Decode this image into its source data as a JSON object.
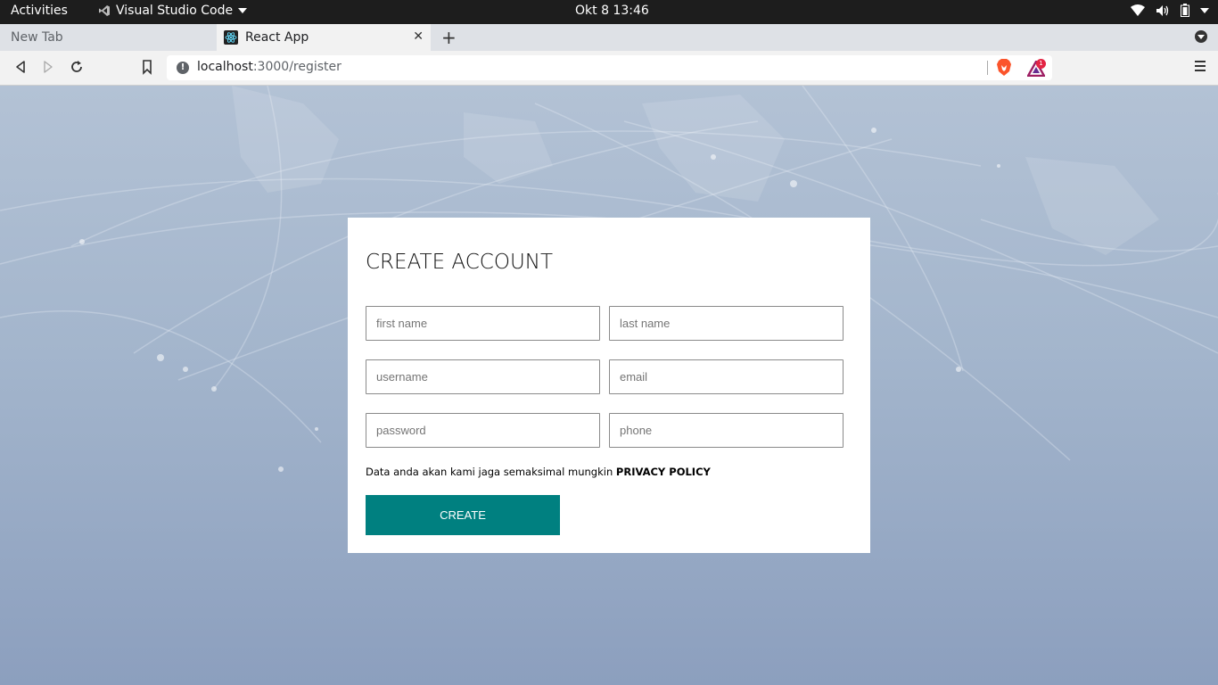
{
  "system": {
    "activities": "Activities",
    "app_name": "Visual Studio Code",
    "clock": "Okt 8  13:46"
  },
  "browser": {
    "tabs": [
      {
        "label": "New Tab",
        "active": false
      },
      {
        "label": "React App",
        "active": true
      }
    ],
    "url_host": "localhost",
    "url_path": ":3000/register",
    "notification_count": "1"
  },
  "form": {
    "title": "CREATE ACCOUNT",
    "fields": [
      {
        "placeholder": "first name",
        "value": ""
      },
      {
        "placeholder": "last name",
        "value": ""
      },
      {
        "placeholder": "username",
        "value": ""
      },
      {
        "placeholder": "email",
        "value": ""
      },
      {
        "placeholder": "password",
        "value": ""
      },
      {
        "placeholder": "phone",
        "value": ""
      }
    ],
    "agreement_text": "Data anda akan kami jaga semaksimal mungkin ",
    "agreement_link": "PRIVACY POLICY",
    "submit_label": "CREATE"
  },
  "colors": {
    "accent": "#008080",
    "topbar": "#1d1d1d",
    "card": "#ffffff"
  },
  "icons": [
    "vscode-icon",
    "dropdown-caret-icon",
    "wifi-icon",
    "volume-icon",
    "battery-icon",
    "power-menu-icon",
    "react-favicon",
    "close-icon",
    "plus-icon",
    "tab-menu-icon",
    "back-icon",
    "forward-icon",
    "reload-icon",
    "bookmark-icon",
    "site-info-icon",
    "brave-shields-icon",
    "brave-rewards-icon",
    "menu-icon"
  ]
}
